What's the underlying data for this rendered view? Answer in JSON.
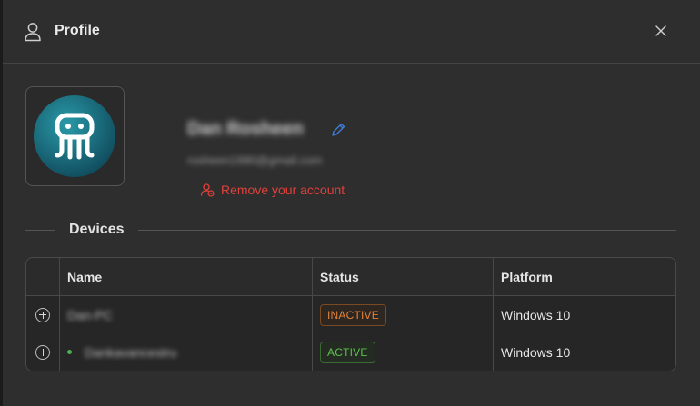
{
  "header": {
    "title": "Profile",
    "title_icon": "user-icon",
    "close_icon": "close-icon"
  },
  "profile": {
    "name": "Dan Rosheen",
    "email": "rosheen1990@gmail.com",
    "edit_icon": "pencil-icon",
    "remove_label": "Remove your account",
    "remove_icon": "remove-user-icon",
    "remove_color": "#e0413b"
  },
  "devices": {
    "section_label": "Devices",
    "columns": [
      "Name",
      "Status",
      "Platform"
    ],
    "rows": [
      {
        "name": "Dan-PC",
        "status": "INACTIVE",
        "platform": "Windows 10",
        "online": false
      },
      {
        "name": "Dankavancestru",
        "status": "ACTIVE",
        "platform": "Windows 10",
        "online": true
      }
    ],
    "inactive_color": "#e3833a",
    "active_color": "#5fc04f"
  }
}
